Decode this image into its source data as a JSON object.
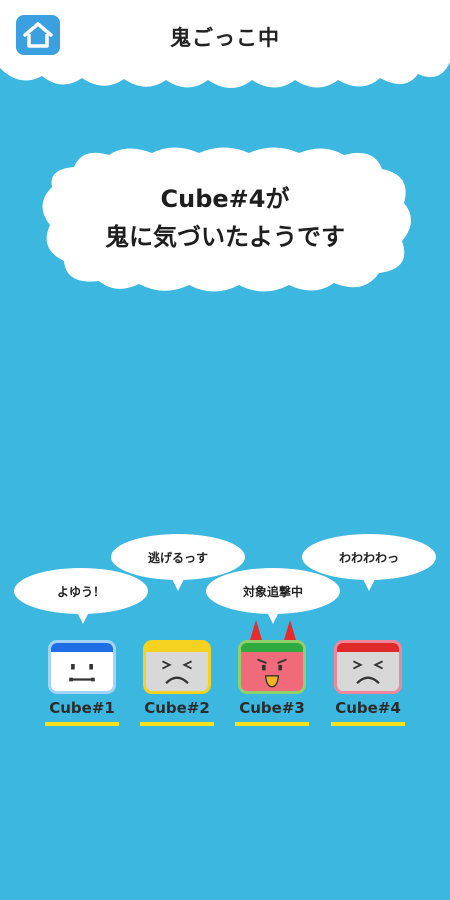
{
  "header": {
    "title": "鬼ごっこ中",
    "home_icon": "home-icon"
  },
  "message": {
    "line1": "Cube#4が",
    "line2": "鬼に気づいたようです"
  },
  "cubes": [
    {
      "name": "Cube#1",
      "bubble": "よゆう！",
      "color": "#1e6fe6",
      "face_bg": "#ffffff",
      "border": "#a3d3ff"
    },
    {
      "name": "Cube#2",
      "bubble": "逃げるっす",
      "color": "#f5d21f",
      "face_bg": "#d8d8d8",
      "border": "#f5d21f"
    },
    {
      "name": "Cube#3",
      "bubble": "対象追撃中",
      "color": "#2faa3f",
      "face_bg": "#f06a7a",
      "border": "#8ed16a"
    },
    {
      "name": "Cube#4",
      "bubble": "わわわわっ",
      "color": "#e02a2a",
      "face_bg": "#d8d8d8",
      "border": "#f0869a"
    }
  ],
  "colors": {
    "background": "#3bb7e0",
    "cloud": "#ffffff",
    "underline": "#f6e21b"
  }
}
